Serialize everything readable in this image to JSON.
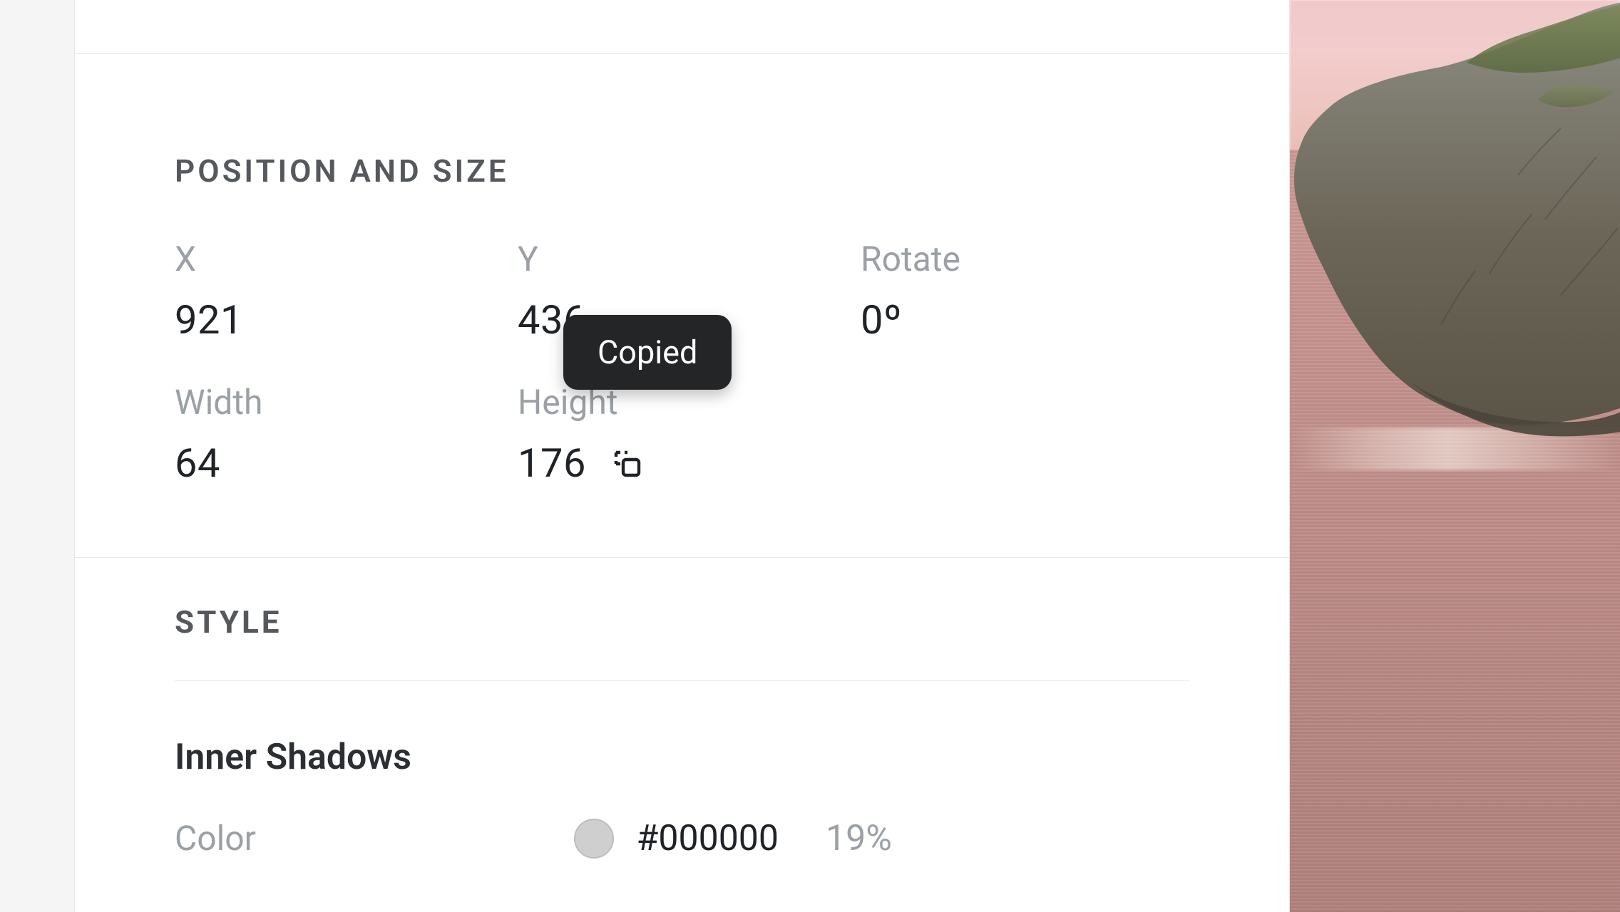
{
  "toast": {
    "text": "Copied"
  },
  "position": {
    "section_title": "POSITION AND SIZE",
    "x_label": "X",
    "x_value": "921",
    "y_label": "Y",
    "y_value": "436",
    "rotate_label": "Rotate",
    "rotate_value": "0º",
    "width_label": "Width",
    "width_value": "64",
    "height_label": "Height",
    "height_value": "176"
  },
  "style": {
    "section_title": "STYLE",
    "inner_shadows_title": "Inner Shadows",
    "color_label": "Color",
    "color_hex": "#000000",
    "color_opacity": "19%",
    "swatch_hex": "#cfcfcf"
  }
}
